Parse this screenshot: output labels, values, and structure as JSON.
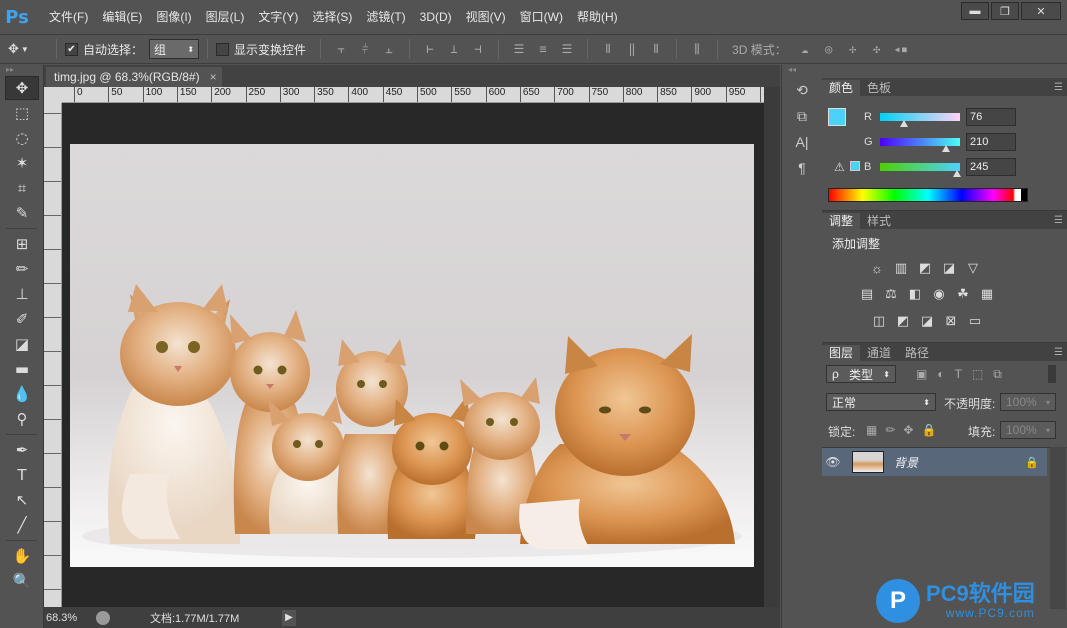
{
  "app": {
    "logo": "Ps"
  },
  "menu": [
    "文件(F)",
    "编辑(E)",
    "图像(I)",
    "图层(L)",
    "文字(Y)",
    "选择(S)",
    "滤镜(T)",
    "3D(D)",
    "视图(V)",
    "窗口(W)",
    "帮助(H)"
  ],
  "window_buttons": {
    "minimize": "▬",
    "restore": "❐",
    "close": "✕"
  },
  "options": {
    "auto_select_label": "自动选择：",
    "auto_select_checked": true,
    "auto_select_target": "组",
    "show_transform_label": "显示变换控件",
    "mode3d_label": "3D 模式："
  },
  "document": {
    "tab_title": "timg.jpg @ 68.3%(RGB/8#)",
    "tab_close": "×",
    "ruler_ticks": [
      "0",
      "50",
      "100",
      "150",
      "200",
      "250",
      "300",
      "350",
      "400",
      "450",
      "500",
      "550",
      "600",
      "650",
      "700",
      "750",
      "800",
      "850",
      "900",
      "950",
      "1"
    ]
  },
  "status": {
    "zoom": "68.3%",
    "doc_info": "文档:1.77M/1.77M",
    "arrow": "▶"
  },
  "color_panel": {
    "tabs": [
      "颜色",
      "色板"
    ],
    "r_label": "R",
    "g_label": "G",
    "b_label": "B",
    "r": "76",
    "g": "210",
    "b": "245",
    "foreground": "#4cd2f5",
    "background": "#000000",
    "warning_icon": "⚠",
    "r_level": 0.3,
    "g_level": 0.82,
    "b_level": 0.96
  },
  "adjust_panel": {
    "tabs": [
      "调整",
      "样式"
    ],
    "title": "添加调整",
    "icons_row1": [
      "☼",
      "▥",
      "◩",
      "◪",
      "▽"
    ],
    "icons_row2": [
      "▤",
      "⚖",
      "◧",
      "◉",
      "☘",
      "▦"
    ],
    "icons_row3": [
      "◫",
      "◩",
      "◪",
      "⊠",
      "▭"
    ]
  },
  "layers_panel": {
    "tabs": [
      "图层",
      "通道",
      "路径"
    ],
    "filter_label": "类型",
    "filter_prefix": "ρ",
    "blend_mode": "正常",
    "opacity_label": "不透明度:",
    "opacity_value": "100%",
    "lock_label": "锁定:",
    "fill_label": "填充:",
    "fill_value": "100%",
    "layer_name": "背景",
    "eye": "👁",
    "lock_icon": "🔒"
  },
  "watermark": {
    "logo_char": "P",
    "title": "PC9软件园",
    "url": "www.PC9.com"
  }
}
